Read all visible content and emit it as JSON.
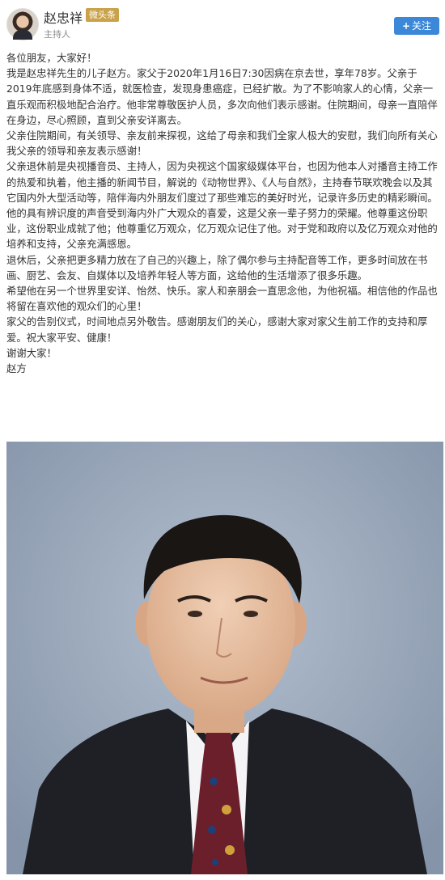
{
  "header": {
    "name": "赵忠祥",
    "badge": "微头条",
    "subtitle": "主持人",
    "follow_label": "关注"
  },
  "article": {
    "paragraphs": [
      "各位朋友，大家好！",
      "我是赵忠祥先生的儿子赵方。家父于2020年1月16日7:30因病在京去世，享年78岁。父亲于2019年底感到身体不适，就医检查，发现身患癌症，已经扩散。为了不影响家人的心情，父亲一直乐观而积极地配合治疗。他非常尊敬医护人员，多次向他们表示感谢。住院期间，母亲一直陪伴在身边，尽心照顾，直到父亲安详离去。",
      "父亲住院期间，有关领导、亲友前来探视，这给了母亲和我们全家人极大的安慰，我们向所有关心我父亲的领导和亲友表示感谢！",
      "父亲退休前是央视播音员、主持人，因为央视这个国家级媒体平台，也因为他本人对播音主持工作的热爱和执着，他主播的新闻节目，解说的《动物世界》、《人与自然》，主持春节联欢晚会以及其它国内外大型活动等，陪伴海内外朋友们度过了那些难忘的美好时光，记录许多历史的精彩瞬间。他的具有辨识度的声音受到海内外广大观众的喜爱，这是父亲一辈子努力的荣耀。他尊重这份职业，这份职业成就了他；他尊重亿万观众，亿万观众记住了他。对于党和政府以及亿万观众对他的培养和支持，父亲充满感恩。",
      "退休后，父亲把更多精力放在了自己的兴趣上，除了偶尔参与主持配音等工作，更多时间放在书画、厨艺、会友、自媒体以及培养年轻人等方面，这给他的生活增添了很多乐趣。",
      "希望他在另一个世界里安详、怡然、快乐。家人和亲朋会一直思念他，为他祝福。相信他的作品也将留在喜欢他的观众们的心里！",
      "家父的告别仪式，时间地点另外敬告。感谢朋友们的关心，感谢大家对家父生前工作的支持和厚爱。祝大家平安、健康！",
      "谢谢大家！",
      "赵方"
    ]
  },
  "colors": {
    "follow_button": "#3b88d8",
    "badge": "#c9a24a",
    "photo_background": "#9eabbd",
    "text": "#333333",
    "muted": "#888888"
  },
  "icons": {
    "follow": "plus-icon"
  }
}
